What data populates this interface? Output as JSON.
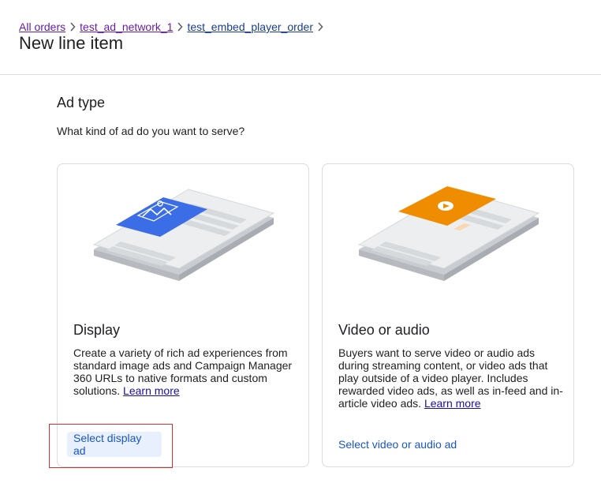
{
  "breadcrumb": {
    "items": [
      {
        "label": "All orders"
      },
      {
        "label": "test_ad_network_1"
      },
      {
        "label": "test_embed_player_order"
      }
    ]
  },
  "page_title": "New line item",
  "section": {
    "title": "Ad type",
    "question": "What kind of ad do you want to serve?"
  },
  "cards": {
    "display": {
      "title": "Display",
      "description": "Create a variety of rich ad experiences from standard image ads and Campaign Manager 360 URLs to native formats and custom solutions.",
      "learn_more": "Learn more",
      "button": "Select display ad",
      "accent": "#3b6ee6"
    },
    "video": {
      "title": "Video or audio",
      "description": "Buyers want to serve video or audio ads during streaming content, or video ads that play outside of a video player. Includes rewarded video ads, as well as in-feed and in-article video ads.",
      "learn_more": "Learn more",
      "button": "Select video or audio ad",
      "accent": "#f08c00"
    }
  },
  "colors": {
    "link": "#1a0dab",
    "border": "#dadce0",
    "highlight": "#d32f2f"
  }
}
